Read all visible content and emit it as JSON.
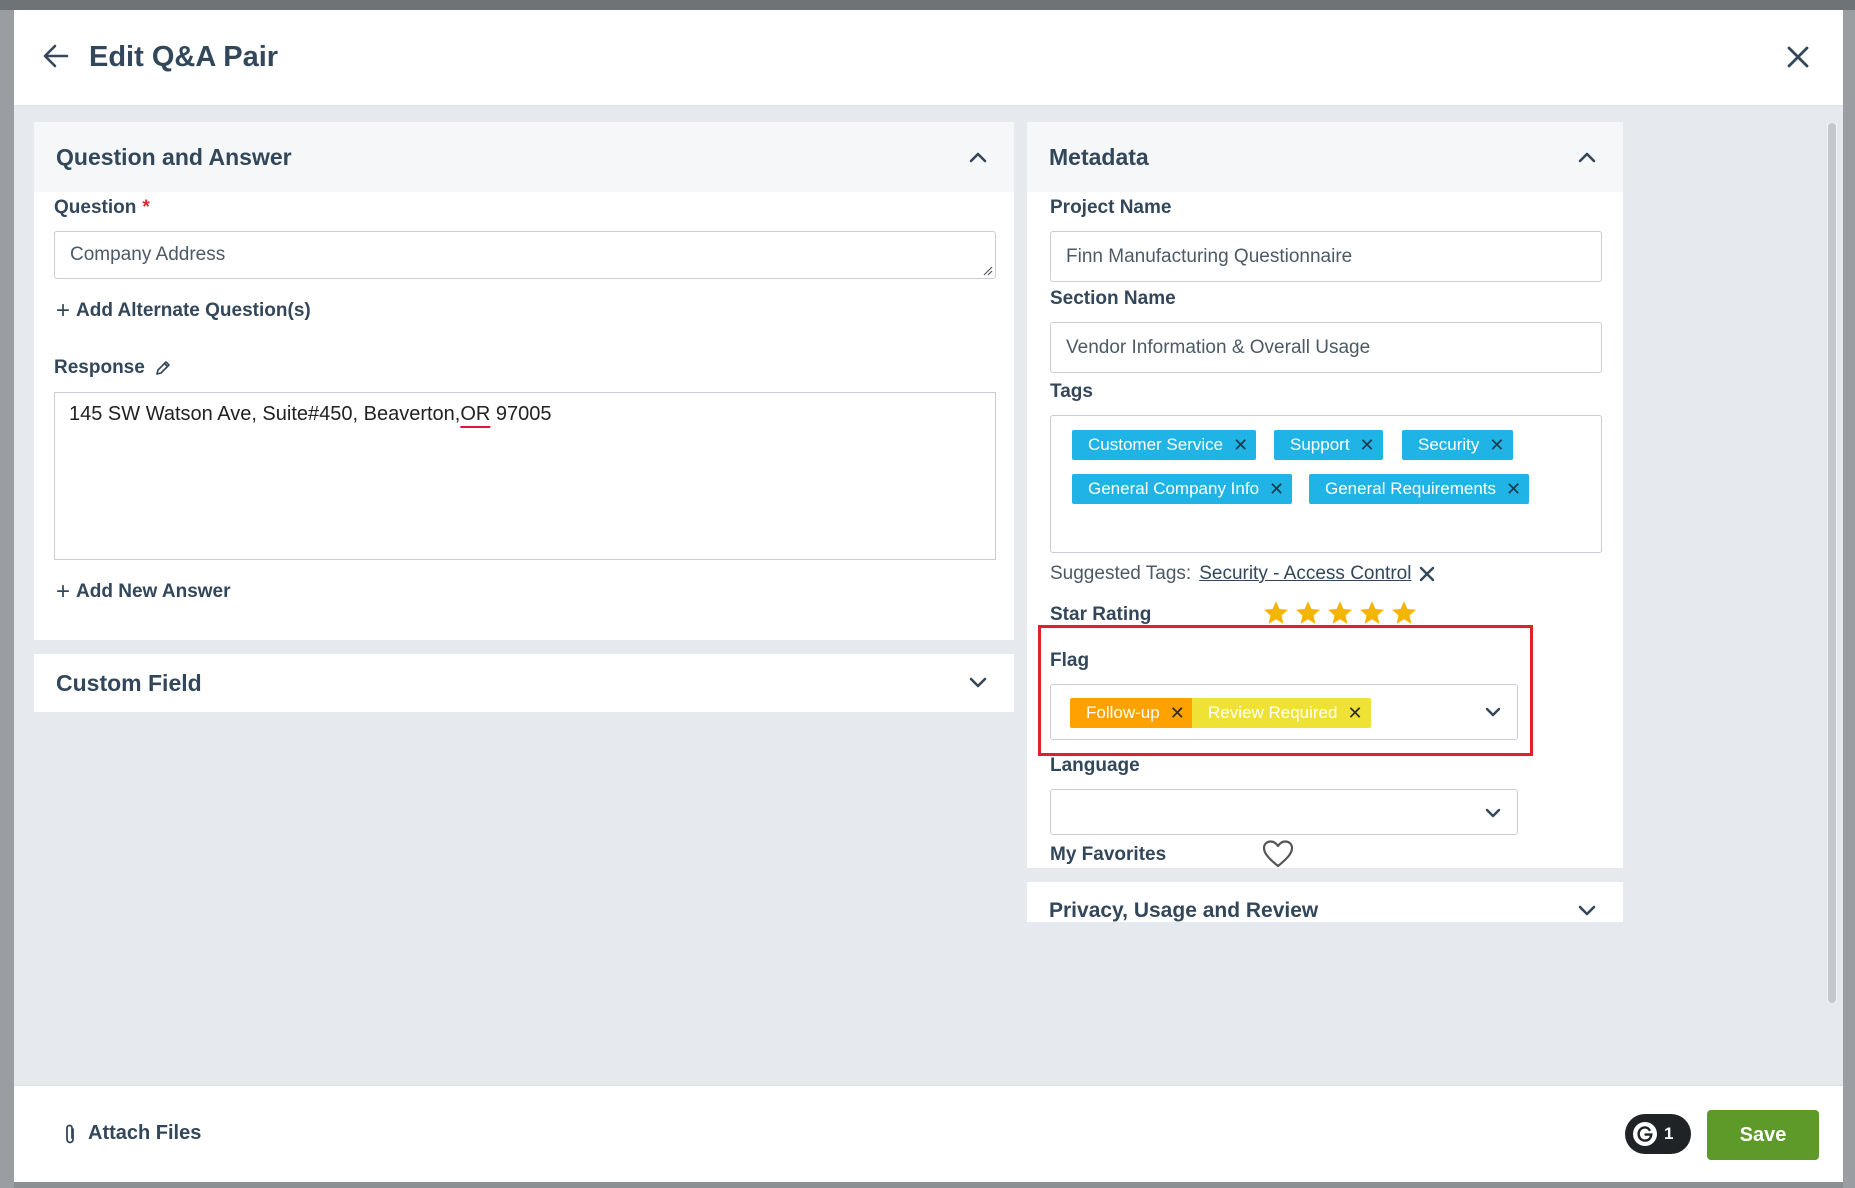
{
  "modal": {
    "title": "Edit Q&A Pair"
  },
  "qa_panel": {
    "title": "Question and Answer",
    "question_label": "Question",
    "required_mark": "*",
    "question_value": "Company Address",
    "add_alternate_label": "Add Alternate Question(s)",
    "response_label": "Response",
    "response_before": "145 SW Watson Ave, Suite#450, Beaverton,",
    "response_flagged_word": "OR",
    "response_after": " 97005",
    "add_answer_label": "Add New Answer"
  },
  "custom_panel": {
    "title": "Custom Field"
  },
  "metadata": {
    "title": "Metadata",
    "project_label": "Project Name",
    "project_value": "Finn Manufacturing Questionnaire",
    "section_label": "Section Name",
    "section_value": "Vendor Information & Overall Usage",
    "tags_label": "Tags",
    "tags": [
      "Customer Service",
      "Support",
      "Security",
      "General Company Info",
      "General Requirements"
    ],
    "suggested_label": "Suggested Tags:",
    "suggested_tag": "Security - Access Control",
    "star_rating_label": "Star Rating",
    "star_rating": 5,
    "flag_label": "Flag",
    "flags": [
      {
        "label": "Follow-up",
        "color": "#ffa200"
      },
      {
        "label": "Review Required",
        "color": "#efe234"
      }
    ],
    "language_label": "Language",
    "language_value": "",
    "favorites_label": "My Favorites"
  },
  "privacy_panel": {
    "title": "Privacy, Usage and Review"
  },
  "footer": {
    "attach_label": "Attach Files",
    "grammarly_count": "1",
    "save_label": "Save"
  },
  "colors": {
    "tag_bg": "#1fb3e6",
    "highlight": "#e0212b",
    "save_bg": "#5e9a2a",
    "star": "#f4b400"
  }
}
